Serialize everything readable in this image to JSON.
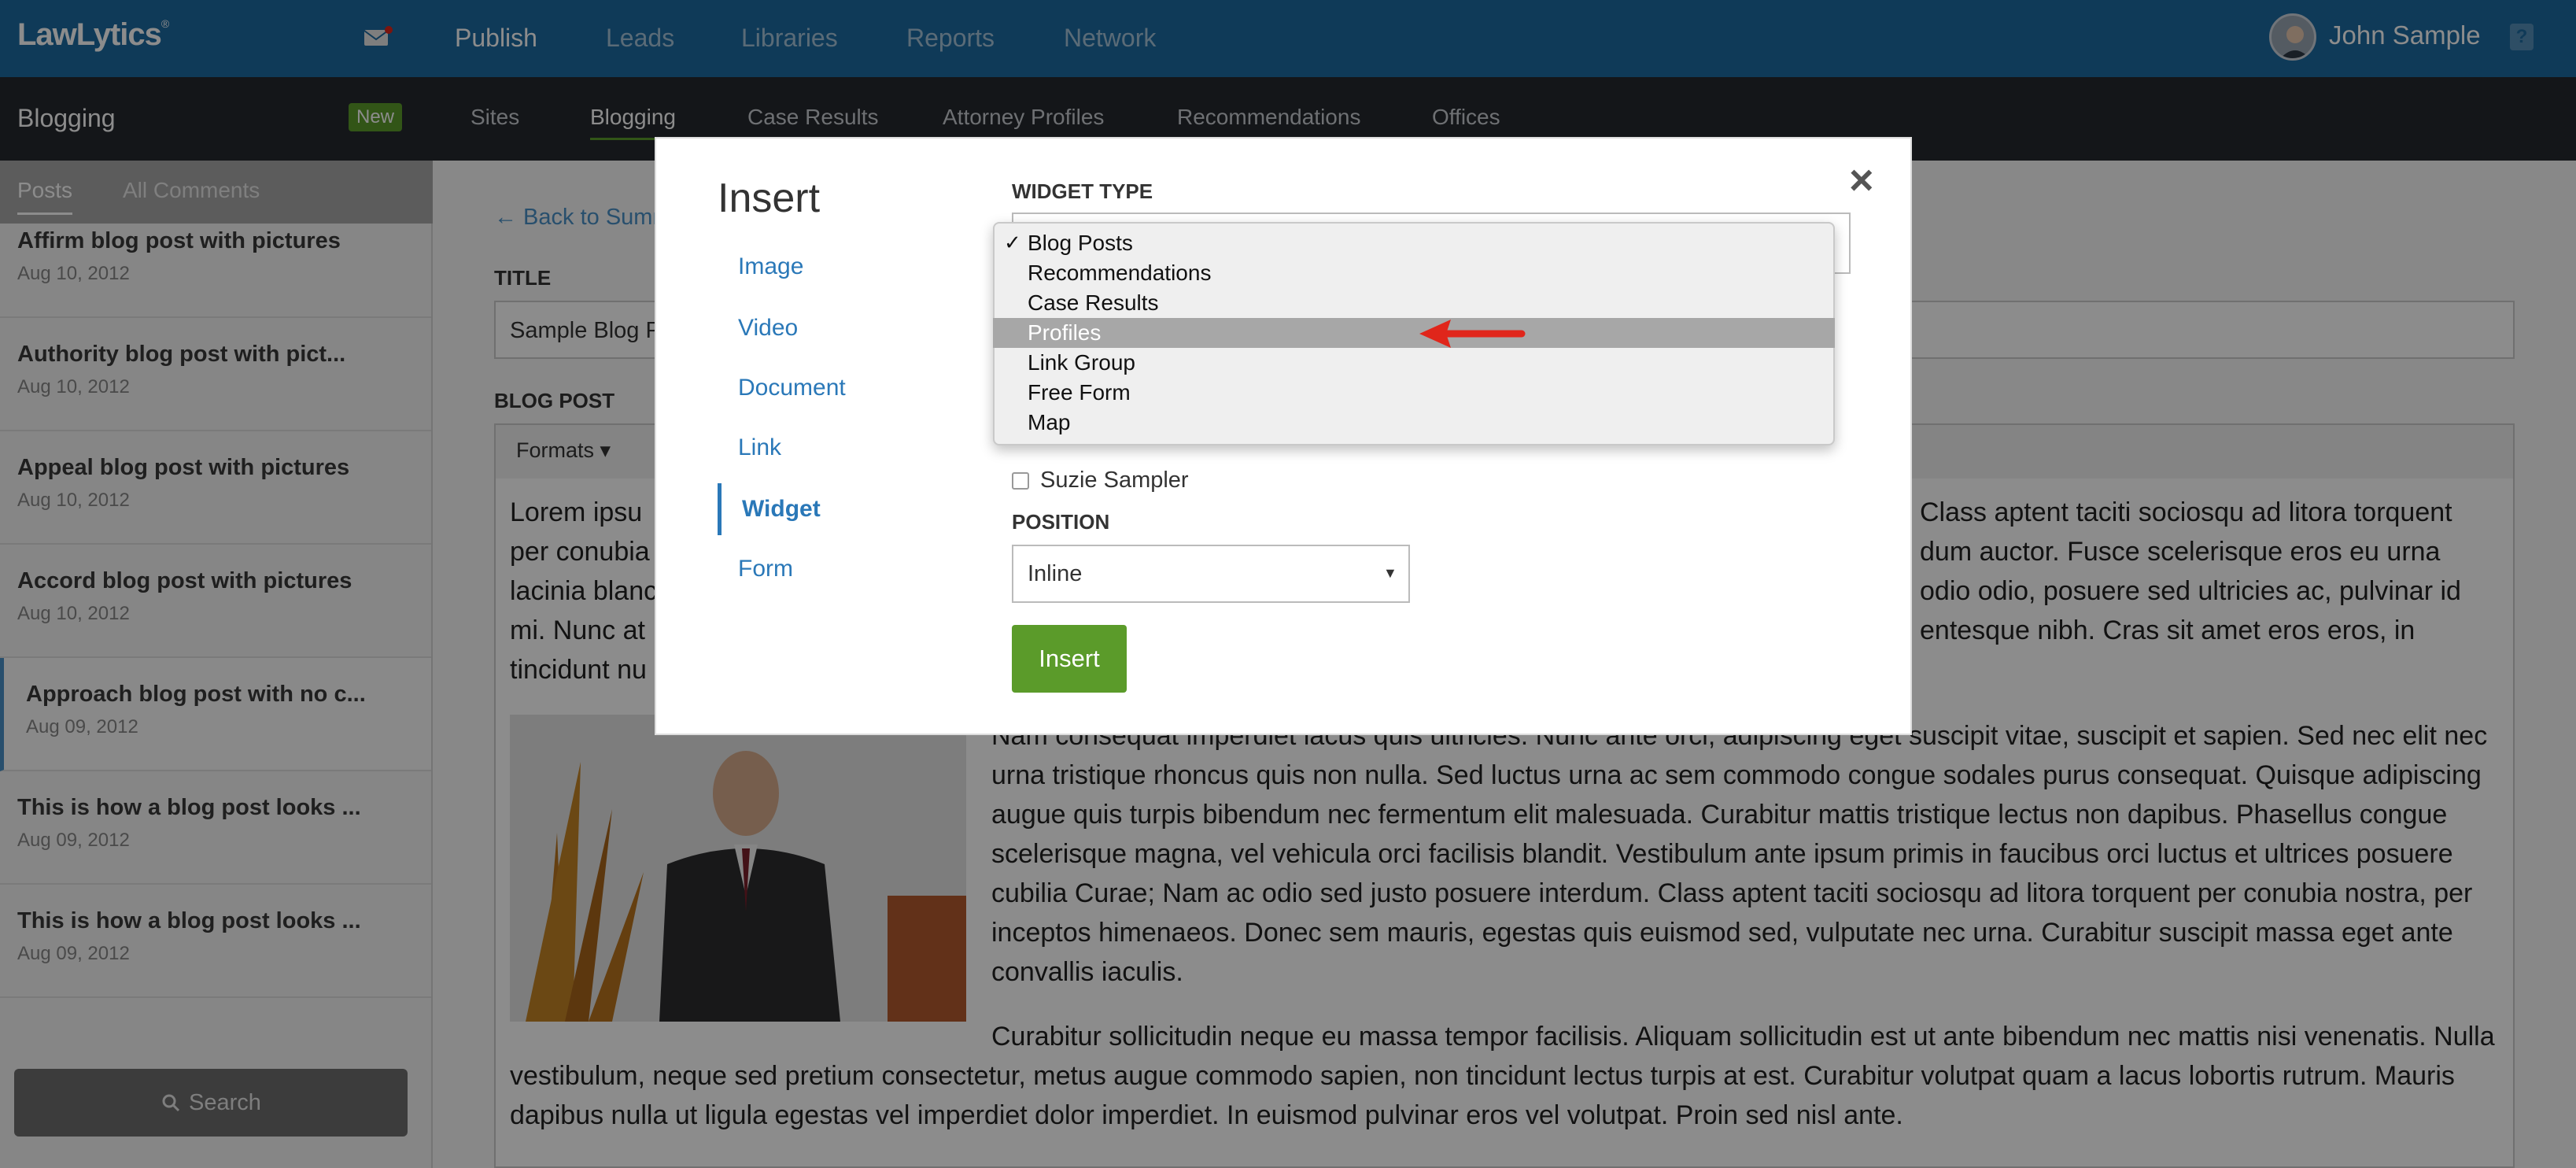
{
  "app": {
    "logo": "LawLytics",
    "logo_mark": "®"
  },
  "topnav": {
    "items": [
      {
        "label": "Publish",
        "active": true
      },
      {
        "label": "Leads",
        "active": false
      },
      {
        "label": "Libraries",
        "active": false
      },
      {
        "label": "Reports",
        "active": false
      },
      {
        "label": "Network",
        "active": false
      }
    ],
    "user_name": "John Sample",
    "help_label": "?"
  },
  "subnav": {
    "section_title": "Blogging",
    "badge": "New",
    "items": [
      {
        "label": "Sites",
        "active": false
      },
      {
        "label": "Blogging",
        "active": true
      },
      {
        "label": "Case Results",
        "active": false
      },
      {
        "label": "Attorney Profiles",
        "active": false
      },
      {
        "label": "Recommendations",
        "active": false
      },
      {
        "label": "Offices",
        "active": false
      }
    ]
  },
  "sidebar": {
    "tabs": [
      {
        "label": "Posts",
        "active": true
      },
      {
        "label": "All Comments",
        "active": false
      }
    ],
    "posts": [
      {
        "title": "Affirm blog post with pictures",
        "date": "Aug 10, 2012"
      },
      {
        "title": "Authority blog post with pict...",
        "date": "Aug 10, 2012"
      },
      {
        "title": "Appeal blog post with pictures",
        "date": "Aug 10, 2012"
      },
      {
        "title": "Accord blog post with pictures",
        "date": "Aug 10, 2012"
      },
      {
        "title": "Approach blog post with no c...",
        "date": "Aug 09, 2012",
        "selected": true
      },
      {
        "title": "This is how a blog post looks ...",
        "date": "Aug 09, 2012"
      },
      {
        "title": "This is how a blog post looks ...",
        "date": "Aug 09, 2012"
      }
    ],
    "search_label": "Search"
  },
  "editor": {
    "back_link": "← Back to Summ",
    "title_label": "TITLE",
    "title_value": "Sample Blog P",
    "post_label": "BLOG POST",
    "formats_label": "Formats ▾",
    "para1_left": "Lorem ipsu\nper conubia\nlacinia blanc\nmi. Nunc at\ntincidunt nu",
    "para1_right": "Class aptent taciti sociosqu ad litora torquent\ndum auctor. Fusce scelerisque eros eu urna\nodio odio, posuere sed ultricies ac, pulvinar id\nentesque nibh. Cras sit amet eros eros, in",
    "para2": "Nam consequat imperdiet lacus quis ultricies. Nunc ante orci, adipiscing eget suscipit vitae, suscipit et sapien. Sed nec elit nec urna tristique rhoncus quis non nulla. Sed luctus urna ac sem commodo congue sodales purus consequat. Quisque adipiscing augue quis turpis bibendum nec fermentum elit malesuada. Curabitur mattis tristique lectus non dapibus. Phasellus congue scelerisque magna, vel vehicula orci facilisis blandit. Vestibulum ante ipsum primis in faucibus orci luctus et ultrices posuere cubilia Curae; Nam ac odio sed justo posuere interdum. Class aptent taciti sociosqu ad litora torquent per conubia nostra, per inceptos himenaeos. Donec sem mauris, egestas quis euismod sed, vulputate nec urna. Curabitur suscipit massa eget ante convallis iaculis.",
    "para3": "Curabitur sollicitudin neque eu massa tempor facilisis. Aliquam sollicitudin est ut ante bibendum nec mattis nisi venenatis. Nulla vestibulum, neque sed pretium consectetur, metus augue commodo sapien, non tincidunt lectus turpis at est. Curabitur volutpat quam a lacus lobortis rutrum. Mauris dapibus nulla ut ligula egestas vel imperdiet dolor imperdiet. In euismod pulvinar eros vel volutpat. Proin sed nisl ante."
  },
  "modal": {
    "title": "Insert",
    "close_label": "×",
    "nav": [
      {
        "label": "Image",
        "active": false
      },
      {
        "label": "Video",
        "active": false
      },
      {
        "label": "Document",
        "active": false
      },
      {
        "label": "Link",
        "active": false
      },
      {
        "label": "Widget",
        "active": true
      },
      {
        "label": "Form",
        "active": false
      }
    ],
    "widget_type_label": "WIDGET TYPE",
    "widget_type_options": [
      {
        "label": "Blog Posts",
        "checked": true
      },
      {
        "label": "Recommendations"
      },
      {
        "label": "Case Results"
      },
      {
        "label": "Profiles",
        "highlighted": true
      },
      {
        "label": "Link Group"
      },
      {
        "label": "Free Form"
      },
      {
        "label": "Map"
      }
    ],
    "checkbox_label": "Suzie Sampler",
    "position_label": "POSITION",
    "position_value": "Inline",
    "insert_button": "Insert"
  },
  "colors": {
    "topbar": "#1d6aa1",
    "subbar": "#25292e",
    "accent_green": "#5b9b2a",
    "link_blue": "#2a78b8",
    "arrow_red": "#e0261b"
  }
}
